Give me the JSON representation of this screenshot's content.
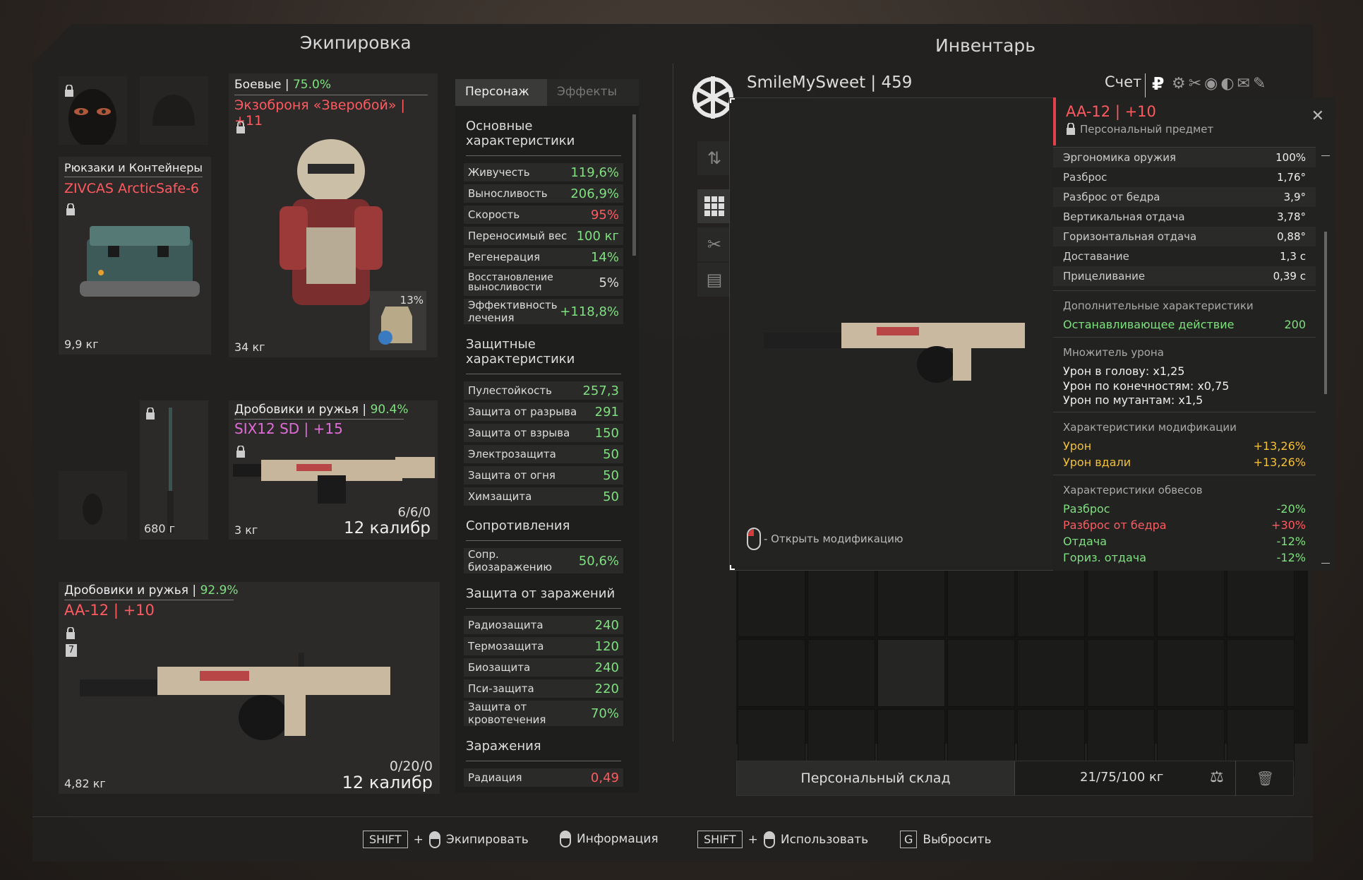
{
  "equipment": {
    "header": "Экипировка",
    "backpack": {
      "category": "Рюкзаки и Контейнеры",
      "name": "ZIVCAS ArcticSafe-6",
      "weight": "9,9 кг"
    },
    "armor": {
      "category": "Боевые",
      "durability": "75.0%",
      "name": "Экзоброня «Зверобой» | +11",
      "weight": "34 кг",
      "plate_percent": "13%"
    },
    "melee": {
      "weight": "680 г"
    },
    "weapon1": {
      "category": "Дробовики и ружья",
      "durability": "90.4%",
      "name": "SIX12 SD | +15",
      "weight": "3 кг",
      "ammo": "6/6/0",
      "caliber": "12 калибр"
    },
    "weapon2": {
      "category": "Дробовики и ружья",
      "durability": "92.9%",
      "name": "AA-12 | +10",
      "weight": "4,82 кг",
      "ammo": "0/20/0",
      "caliber": "12 калибр",
      "slot_number": "7"
    }
  },
  "stats": {
    "tabs": [
      "Персонаж",
      "Эффекты"
    ],
    "sections": {
      "basic": {
        "title": "Основные характеристики",
        "rows": [
          {
            "label": "Живучесть",
            "value": "119,6%",
            "color": "#7fe07f"
          },
          {
            "label": "Выносливость",
            "value": "206,9%",
            "color": "#7fe07f"
          },
          {
            "label": "Скорость",
            "value": "95%",
            "color": "#ff5a60"
          },
          {
            "label": "Переносимый вес",
            "value": "100 кг",
            "color": "#7fe07f"
          },
          {
            "label": "Регенерация",
            "value": "14%",
            "color": "#7fe07f"
          },
          {
            "label": "Восстановление выносливости",
            "value": "5%",
            "color": "#dddddd"
          },
          {
            "label": "Эффективность лечения",
            "value": "+118,8%",
            "color": "#7fe07f"
          }
        ]
      },
      "protect": {
        "title": "Защитные характеристики",
        "rows": [
          {
            "label": "Пулестойкость",
            "value": "257,3",
            "color": "#7fe07f"
          },
          {
            "label": "Защита от разрыва",
            "value": "291",
            "color": "#7fe07f"
          },
          {
            "label": "Защита от взрыва",
            "value": "150",
            "color": "#7fe07f"
          },
          {
            "label": "Электрозащита",
            "value": "50",
            "color": "#7fe07f"
          },
          {
            "label": "Защита от огня",
            "value": "50",
            "color": "#7fe07f"
          },
          {
            "label": "Химзащита",
            "value": "50",
            "color": "#7fe07f"
          }
        ]
      },
      "resist": {
        "title": "Сопротивления",
        "rows": [
          {
            "label": "Сопр. биозаражению",
            "value": "50,6%",
            "color": "#7fe07f"
          }
        ]
      },
      "contam": {
        "title": "Защита от заражений",
        "rows": [
          {
            "label": "Радиозащита",
            "value": "240",
            "color": "#7fe07f"
          },
          {
            "label": "Термозащита",
            "value": "120",
            "color": "#7fe07f"
          },
          {
            "label": "Биозащита",
            "value": "240",
            "color": "#7fe07f"
          },
          {
            "label": "Пси-защита",
            "value": "220",
            "color": "#7fe07f"
          },
          {
            "label": "Защита от кровотечения",
            "value": "70%",
            "color": "#7fe07f"
          }
        ]
      },
      "infect": {
        "title": "Заражения",
        "rows": [
          {
            "label": "Радиация",
            "value": "0,49",
            "color": "#ff5a60"
          }
        ]
      }
    }
  },
  "inventory": {
    "header": "Инвентарь",
    "player": "SmileMySweet | 459",
    "account_label": "Счет",
    "storage_button": "Персональный склад",
    "weight": "21/75/100 кг"
  },
  "popup": {
    "open_mod_hint": "- Открыть модификацию",
    "item_name": "AA-12 | +10",
    "item_subtitle": "Персональный предмет",
    "main_stats": [
      {
        "label": "Эргономика оружия",
        "value": "100%"
      },
      {
        "label": "Разброс",
        "value": "1,76°"
      },
      {
        "label": "Разброс от бедра",
        "value": "3,9°"
      },
      {
        "label": "Вертикальная отдача",
        "value": "3,78°"
      },
      {
        "label": "Горизонтальная отдача",
        "value": "0,88°"
      },
      {
        "label": "Доставание",
        "value": "1,3 с"
      },
      {
        "label": "Прицеливание",
        "value": "0,39 с"
      }
    ],
    "extra": {
      "title": "Дополнительные характеристики",
      "label": "Останавливающее действие",
      "value": "200"
    },
    "damage_mult": {
      "title": "Множитель урона",
      "lines": [
        "Урон в голову: x1,25",
        "Урон по конечностям: x0,75",
        "Урон по мутантам: x1,5"
      ]
    },
    "mod_stats": {
      "title": "Характеристики модификации",
      "rows": [
        {
          "label": "Урон",
          "value": "+13,26%"
        },
        {
          "label": "Урон вдали",
          "value": "+13,26%"
        }
      ]
    },
    "attach_stats": {
      "title": "Характеристики обвесов",
      "rows": [
        {
          "label": "Разброс",
          "value": "-20%",
          "color": "#7fe07f"
        },
        {
          "label": "Разброс от бедра",
          "value": "+30%",
          "color": "#ff5a60"
        },
        {
          "label": "Отдача",
          "value": "-12%",
          "color": "#7fe07f"
        },
        {
          "label": "Гориз. отдача",
          "value": "-12%",
          "color": "#7fe07f"
        }
      ]
    }
  },
  "hints": {
    "shift_key": "SHIFT",
    "plus": "+",
    "equip": "Экипировать",
    "info": "Информация",
    "use": "Использовать",
    "g_key": "G",
    "drop": "Выбросить"
  }
}
